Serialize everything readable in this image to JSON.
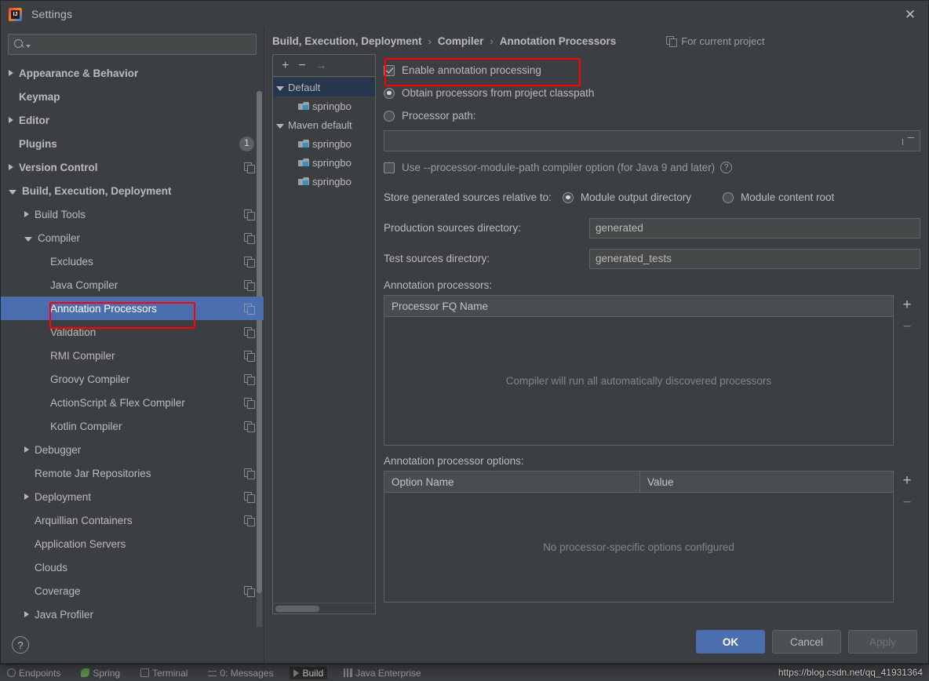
{
  "window": {
    "title": "Settings",
    "close_label": "✕",
    "logo_text": "IJ"
  },
  "search": {
    "value": "",
    "placeholder": ""
  },
  "sidebar": {
    "items": [
      {
        "label": "Appearance & Behavior",
        "arrow": "collapsed",
        "indent": 0,
        "bold": true,
        "badge": null,
        "copy": false,
        "selected": false
      },
      {
        "label": "Keymap",
        "arrow": "none",
        "indent": 0,
        "bold": true,
        "badge": null,
        "copy": false,
        "selected": false
      },
      {
        "label": "Editor",
        "arrow": "collapsed",
        "indent": 0,
        "bold": true,
        "badge": null,
        "copy": false,
        "selected": false
      },
      {
        "label": "Plugins",
        "arrow": "none",
        "indent": 0,
        "bold": true,
        "badge": "1",
        "copy": false,
        "selected": false
      },
      {
        "label": "Version Control",
        "arrow": "collapsed",
        "indent": 0,
        "bold": true,
        "badge": null,
        "copy": true,
        "selected": false
      },
      {
        "label": "Build, Execution, Deployment",
        "arrow": "expanded",
        "indent": 0,
        "bold": true,
        "badge": null,
        "copy": false,
        "selected": false
      },
      {
        "label": "Build Tools",
        "arrow": "collapsed",
        "indent": 1,
        "bold": false,
        "badge": null,
        "copy": true,
        "selected": false
      },
      {
        "label": "Compiler",
        "arrow": "expanded",
        "indent": 1,
        "bold": false,
        "badge": null,
        "copy": true,
        "selected": false
      },
      {
        "label": "Excludes",
        "arrow": "none",
        "indent": 2,
        "bold": false,
        "badge": null,
        "copy": true,
        "selected": false
      },
      {
        "label": "Java Compiler",
        "arrow": "none",
        "indent": 2,
        "bold": false,
        "badge": null,
        "copy": true,
        "selected": false
      },
      {
        "label": "Annotation Processors",
        "arrow": "none",
        "indent": 2,
        "bold": false,
        "badge": null,
        "copy": true,
        "selected": true
      },
      {
        "label": "Validation",
        "arrow": "none",
        "indent": 2,
        "bold": false,
        "badge": null,
        "copy": true,
        "selected": false
      },
      {
        "label": "RMI Compiler",
        "arrow": "none",
        "indent": 2,
        "bold": false,
        "badge": null,
        "copy": true,
        "selected": false
      },
      {
        "label": "Groovy Compiler",
        "arrow": "none",
        "indent": 2,
        "bold": false,
        "badge": null,
        "copy": true,
        "selected": false
      },
      {
        "label": "ActionScript & Flex Compiler",
        "arrow": "none",
        "indent": 2,
        "bold": false,
        "badge": null,
        "copy": true,
        "selected": false
      },
      {
        "label": "Kotlin Compiler",
        "arrow": "none",
        "indent": 2,
        "bold": false,
        "badge": null,
        "copy": true,
        "selected": false
      },
      {
        "label": "Debugger",
        "arrow": "collapsed",
        "indent": 1,
        "bold": false,
        "badge": null,
        "copy": false,
        "selected": false
      },
      {
        "label": "Remote Jar Repositories",
        "arrow": "none",
        "indent": 1,
        "bold": false,
        "badge": null,
        "copy": true,
        "selected": false
      },
      {
        "label": "Deployment",
        "arrow": "collapsed",
        "indent": 1,
        "bold": false,
        "badge": null,
        "copy": true,
        "selected": false
      },
      {
        "label": "Arquillian Containers",
        "arrow": "none",
        "indent": 1,
        "bold": false,
        "badge": null,
        "copy": true,
        "selected": false
      },
      {
        "label": "Application Servers",
        "arrow": "none",
        "indent": 1,
        "bold": false,
        "badge": null,
        "copy": false,
        "selected": false
      },
      {
        "label": "Clouds",
        "arrow": "none",
        "indent": 1,
        "bold": false,
        "badge": null,
        "copy": false,
        "selected": false
      },
      {
        "label": "Coverage",
        "arrow": "none",
        "indent": 1,
        "bold": false,
        "badge": null,
        "copy": true,
        "selected": false
      },
      {
        "label": "Java Profiler",
        "arrow": "collapsed",
        "indent": 1,
        "bold": false,
        "badge": null,
        "copy": false,
        "selected": false
      }
    ],
    "help_label": "?"
  },
  "breadcrumb": {
    "parts": [
      "Build, Execution, Deployment",
      "Compiler",
      "Annotation Processors"
    ],
    "separator": "›",
    "scope_label": "For current project"
  },
  "module_panel": {
    "toolbar": {
      "add": "+",
      "remove": "−",
      "move": "→"
    },
    "items": [
      {
        "label": "Default",
        "type": "group",
        "arrow": "expanded",
        "selected": true
      },
      {
        "label": "springbo",
        "type": "module",
        "arrow": "none",
        "selected": false
      },
      {
        "label": "Maven default",
        "type": "group",
        "arrow": "expanded",
        "selected": false
      },
      {
        "label": "springbo",
        "type": "module",
        "arrow": "none",
        "selected": false
      },
      {
        "label": "springbo",
        "type": "module",
        "arrow": "none",
        "selected": false
      },
      {
        "label": "springbo",
        "type": "module",
        "arrow": "none",
        "selected": false
      }
    ]
  },
  "form": {
    "enable_annotation_processing": {
      "label": "Enable annotation processing",
      "checked": true
    },
    "obtain_from_classpath": {
      "label": "Obtain processors from project classpath",
      "selected": true
    },
    "processor_path": {
      "label": "Processor path:",
      "selected": false,
      "value": "",
      "browse_icon": "folder-icon"
    },
    "use_module_path": {
      "label": "Use --processor-module-path compiler option (for Java 9 and later)",
      "checked": false,
      "help": "?"
    },
    "store_relative_label": "Store generated sources relative to:",
    "store_options": [
      {
        "label": "Module output directory",
        "selected": true
      },
      {
        "label": "Module content root",
        "selected": false
      }
    ],
    "production_sources": {
      "label": "Production sources directory:",
      "value": "generated"
    },
    "test_sources": {
      "label": "Test sources directory:",
      "value": "generated_tests"
    },
    "processors_table": {
      "title": "Annotation processors:",
      "columns": [
        "Processor FQ Name"
      ],
      "rows": [],
      "empty_message": "Compiler will run all automatically discovered processors",
      "add": "+",
      "remove": "−"
    },
    "options_table": {
      "title": "Annotation processor options:",
      "columns": [
        "Option Name",
        "Value"
      ],
      "rows": [],
      "empty_message": "No processor-specific options configured",
      "add": "+",
      "remove": "−"
    }
  },
  "footer": {
    "ok": "OK",
    "cancel": "Cancel",
    "apply": "Apply"
  },
  "ide_background": {
    "tools": [
      {
        "label": "Endpoints",
        "icon": "endpoint-icon",
        "active": false
      },
      {
        "label": "Spring",
        "icon": "spring-icon",
        "active": false
      },
      {
        "label": "Terminal",
        "icon": "terminal-icon",
        "active": false
      },
      {
        "label": "0: Messages",
        "icon": "messages-icon",
        "active": false
      },
      {
        "label": "Build",
        "icon": "build-icon",
        "active": true
      },
      {
        "label": "Java Enterprise",
        "icon": "java-enterprise-icon",
        "active": false
      }
    ]
  },
  "watermark": {
    "text": "https://blog.csdn.net/qq_41931364"
  },
  "colors": {
    "accent": "#4b6eaf",
    "annotation": "#fe0000",
    "panel": "#3c3f41",
    "field": "#45494a"
  }
}
